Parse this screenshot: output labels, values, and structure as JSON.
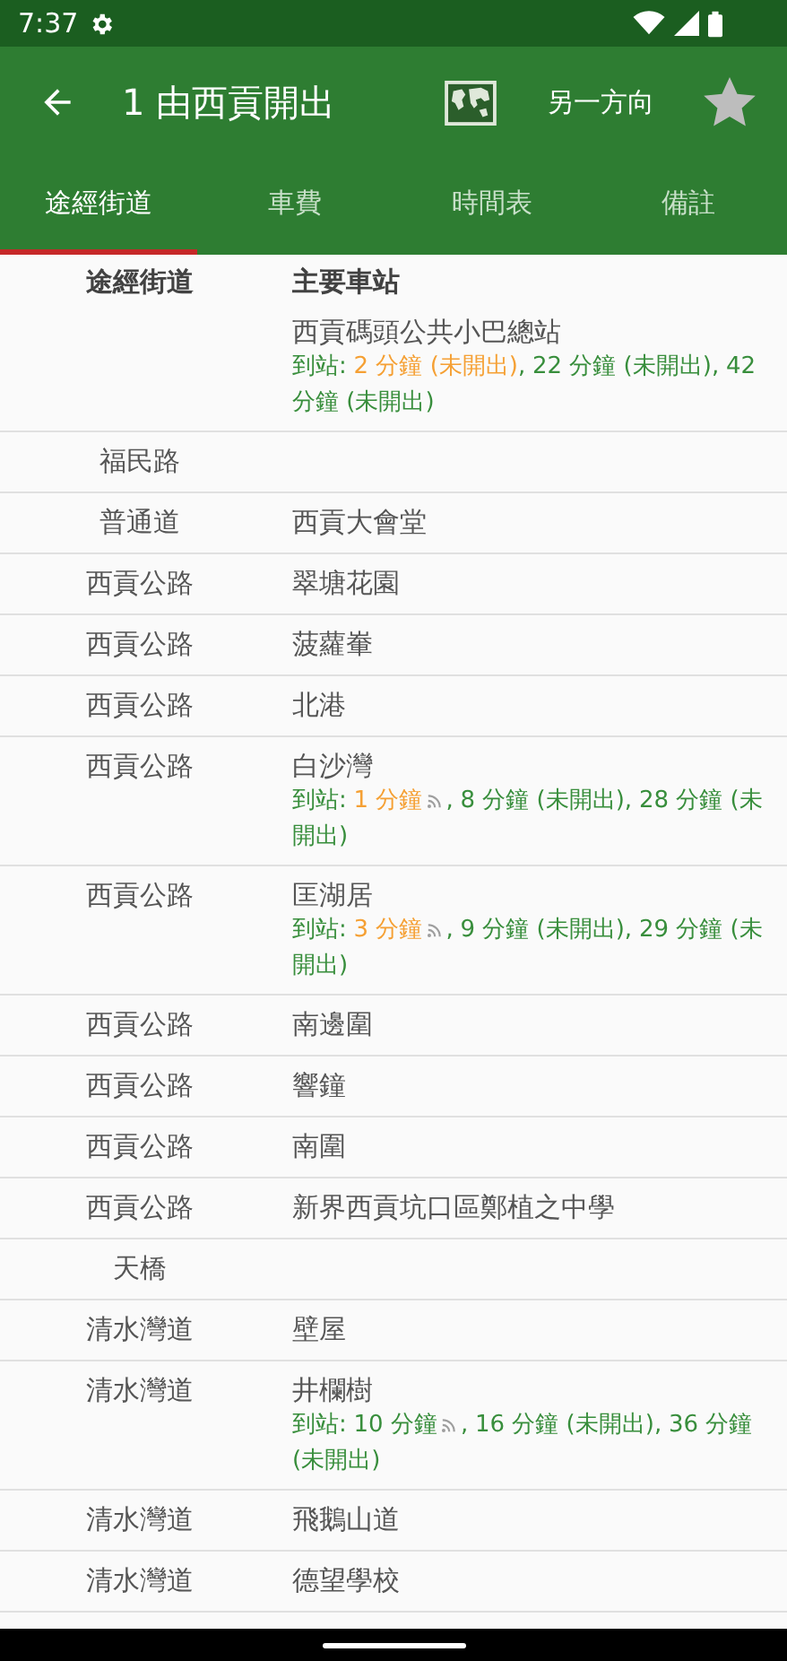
{
  "status_bar": {
    "time": "7:37"
  },
  "app_bar": {
    "title": "1 由西貢開出",
    "direction_button": "另一方向",
    "favorite": false
  },
  "tabs": [
    {
      "label": "途經街道",
      "selected": true
    },
    {
      "label": "車費",
      "selected": false
    },
    {
      "label": "時間表",
      "selected": false
    },
    {
      "label": "備註",
      "selected": false
    }
  ],
  "table": {
    "columns": [
      "途經街道",
      "主要車站"
    ],
    "rows": [
      {
        "stop": "西貢碼頭公共小巴總站",
        "eta": {
          "label": "到站:",
          "separator": ",",
          "arrivals": [
            {
              "text": "2 分鐘 (未開出)",
              "soon": true,
              "live": false
            },
            {
              "text": "22 分鐘 (未開出)",
              "soon": false,
              "live": false
            },
            {
              "text": "42 分鐘 (未開出)",
              "soon": false,
              "live": false
            }
          ]
        }
      },
      {
        "street": "福民路"
      },
      {
        "street": "普通道",
        "stop": "西貢大會堂"
      },
      {
        "street": "西貢公路",
        "stop": "翠塘花園"
      },
      {
        "street": "西貢公路",
        "stop": "菠蘿輋"
      },
      {
        "street": "西貢公路",
        "stop": "北港"
      },
      {
        "street": "西貢公路",
        "stop": "白沙灣",
        "eta": {
          "label": "到站:",
          "separator": ",",
          "arrivals": [
            {
              "text": "1 分鐘",
              "soon": true,
              "live": true
            },
            {
              "text": "8 分鐘 (未開出)",
              "soon": false,
              "live": false
            },
            {
              "text": "28 分鐘 (未開出)",
              "soon": false,
              "live": false
            }
          ]
        }
      },
      {
        "street": "西貢公路",
        "stop": "匡湖居",
        "eta": {
          "label": "到站:",
          "separator": ",",
          "arrivals": [
            {
              "text": "3 分鐘",
              "soon": true,
              "live": true
            },
            {
              "text": "9 分鐘 (未開出)",
              "soon": false,
              "live": false
            },
            {
              "text": "29 分鐘 (未開出)",
              "soon": false,
              "live": false
            }
          ]
        }
      },
      {
        "street": "西貢公路",
        "stop": "南邊圍"
      },
      {
        "street": "西貢公路",
        "stop": "響鐘"
      },
      {
        "street": "西貢公路",
        "stop": "南圍"
      },
      {
        "street": "西貢公路",
        "stop": "新界西貢坑口區鄭植之中學"
      },
      {
        "street": "天橋"
      },
      {
        "street": "清水灣道",
        "stop": "壁屋"
      },
      {
        "street": "清水灣道",
        "stop": "井欄樹",
        "eta": {
          "label": "到站:",
          "separator": ",",
          "arrivals": [
            {
              "text": "10 分鐘",
              "soon": false,
              "live": true
            },
            {
              "text": "16 分鐘 (未開出)",
              "soon": false,
              "live": false
            },
            {
              "text": "36 分鐘 (未開出)",
              "soon": false,
              "live": false
            }
          ]
        }
      },
      {
        "street": "清水灣道",
        "stop": "飛鵝山道"
      },
      {
        "street": "清水灣道",
        "stop": "德望學校"
      }
    ]
  }
}
